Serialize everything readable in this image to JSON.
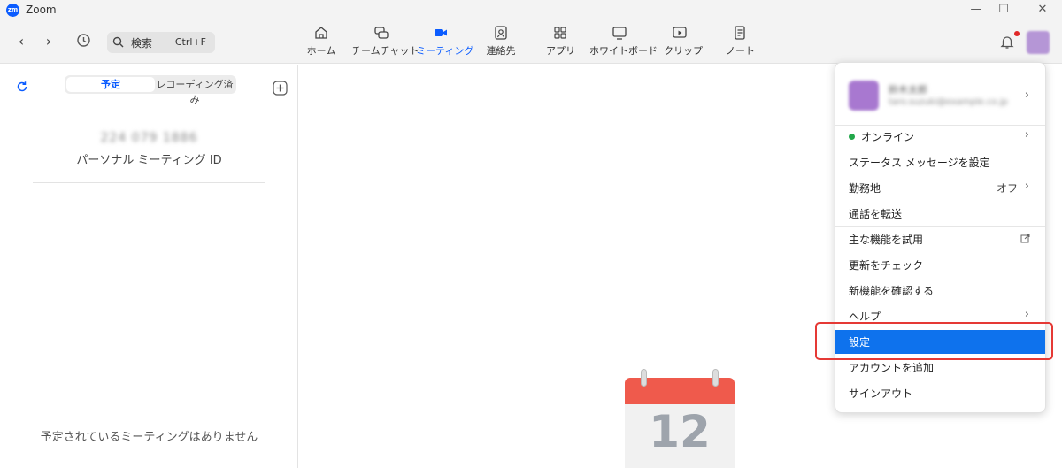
{
  "window": {
    "title": "Zoom",
    "logo_text": "zm"
  },
  "toolbar": {
    "search_placeholder": "検索",
    "search_shortcut": "Ctrl+F",
    "tabs": [
      {
        "label": "ホーム",
        "icon": "home-icon"
      },
      {
        "label": "チームチャット",
        "icon": "chat-icon"
      },
      {
        "label": "ミーティング",
        "icon": "video-icon",
        "active": true
      },
      {
        "label": "連絡先",
        "icon": "contacts-icon"
      },
      {
        "label": "アプリ",
        "icon": "apps-icon"
      },
      {
        "label": "ホワイトボード",
        "icon": "whiteboard-icon"
      },
      {
        "label": "クリップ",
        "icon": "clips-icon"
      },
      {
        "label": "ノート",
        "icon": "notes-icon"
      }
    ]
  },
  "left_panel": {
    "segment": {
      "scheduled": "予定",
      "recorded": "レコーディング済み"
    },
    "pmi_number": "224 079 1886",
    "pmi_label": "パーソナル ミーティング ID",
    "empty_message": "予定されているミーティングはありません"
  },
  "calendar": {
    "day": "12"
  },
  "menu": {
    "profile": {
      "name": "鈴木太郎",
      "email": "taro.suzuki@example.co.jp"
    },
    "status": "オンライン",
    "items": {
      "set_status_message": "ステータス メッセージを設定",
      "work_location": "勤務地",
      "work_location_value": "オフ",
      "call_forward": "通話を転送",
      "try_features": "主な機能を試用",
      "check_updates": "更新をチェック",
      "whats_new": "新機能を確認する",
      "help": "ヘルプ",
      "settings": "設定",
      "add_account": "アカウントを追加",
      "sign_out": "サインアウト"
    }
  },
  "colors": {
    "accent": "#0b5cff",
    "menu_highlight": "#0e72ed",
    "callout": "#e53935",
    "online": "#22a74a"
  }
}
